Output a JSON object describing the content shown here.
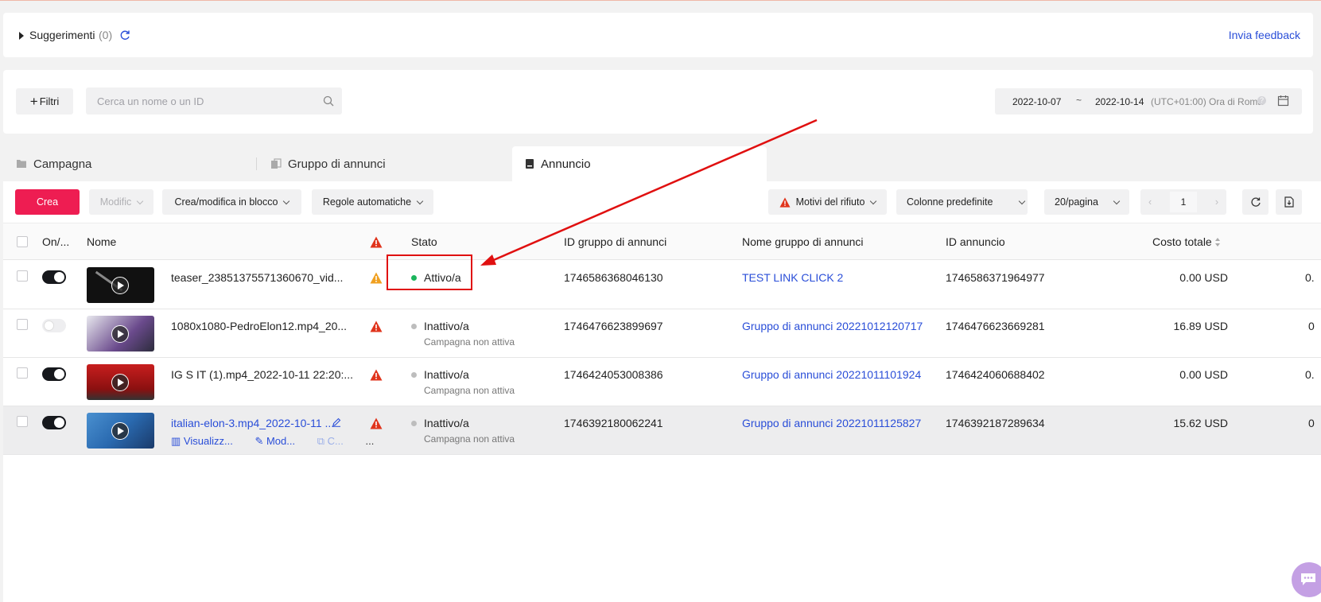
{
  "suggestions": {
    "title": "Suggerimenti",
    "count": "(0)",
    "feedback": "Invia feedback"
  },
  "filters": {
    "button": "Filtri",
    "search_placeholder": "Cerca un nome o un ID"
  },
  "daterange": {
    "start": "2022-10-07",
    "sep": "~",
    "end": "2022-10-14",
    "timezone": "(UTC+01:00) Ora di Roma"
  },
  "tabs": [
    {
      "label": "Campagna"
    },
    {
      "label": "Gruppo di annunci"
    },
    {
      "label": "Annuncio"
    }
  ],
  "toolbar": {
    "crea": "Crea",
    "modifica": "Modific",
    "bulk": "Crea/modifica in blocco",
    "rules": "Regole automatiche",
    "rejection": "Motivi del rifiuto",
    "columns": "Colonne predefinite",
    "per_page": "20/pagina",
    "page": "1"
  },
  "table": {
    "headers": {
      "onoff": "On/...",
      "name": "Nome",
      "status": "Stato",
      "adgroup_id": "ID gruppo di annunci",
      "adgroup_name": "Nome gruppo di annunci",
      "ad_id": "ID annuncio",
      "cost": "Costo totale"
    },
    "rows": [
      {
        "on": true,
        "name": "teaser_23851375571360670_vid...",
        "status": "Attivo/a",
        "substatus": "",
        "adgroup_id": "1746586368046130",
        "adgroup_name": "TEST LINK CLICK 2",
        "ad_id": "1746586371964977",
        "cost": "0.00 USD",
        "extra": "0."
      },
      {
        "on": false,
        "name": "1080x1080-PedroElon12.mp4_20...",
        "status": "Inattivo/a",
        "substatus": "Campagna non attiva",
        "adgroup_id": "1746476623899697",
        "adgroup_name": "Gruppo di annunci 20221012120717",
        "ad_id": "1746476623669281",
        "cost": "16.89 USD",
        "extra": "0"
      },
      {
        "on": true,
        "name": "IG S IT (1).mp4_2022-10-11 22:20:...",
        "status": "Inattivo/a",
        "substatus": "Campagna non attiva",
        "adgroup_id": "1746424053008386",
        "adgroup_name": "Gruppo di annunci 20221011101924",
        "ad_id": "1746424060688402",
        "cost": "0.00 USD",
        "extra": "0."
      },
      {
        "on": true,
        "name": "italian-elon-3.mp4_2022-10-11 ...",
        "status": "Inattivo/a",
        "substatus": "Campagna non attiva",
        "adgroup_id": "1746392180062241",
        "adgroup_name": "Gruppo di annunci 20221011125827",
        "ad_id": "1746392187289634",
        "cost": "15.62 USD",
        "extra": "0"
      }
    ],
    "row_actions": {
      "view": "Visualizz...",
      "edit": "Mod...",
      "copy": "C...",
      "more": "..."
    }
  },
  "colors": {
    "accent": "#ee1d52",
    "link": "#2a4ed8",
    "active_dot": "#1bb55c",
    "inactive_dot": "#bdbdbd",
    "warn_red": "#e0341c",
    "warn_orange": "#f0a020",
    "annotation": "#e01010"
  }
}
